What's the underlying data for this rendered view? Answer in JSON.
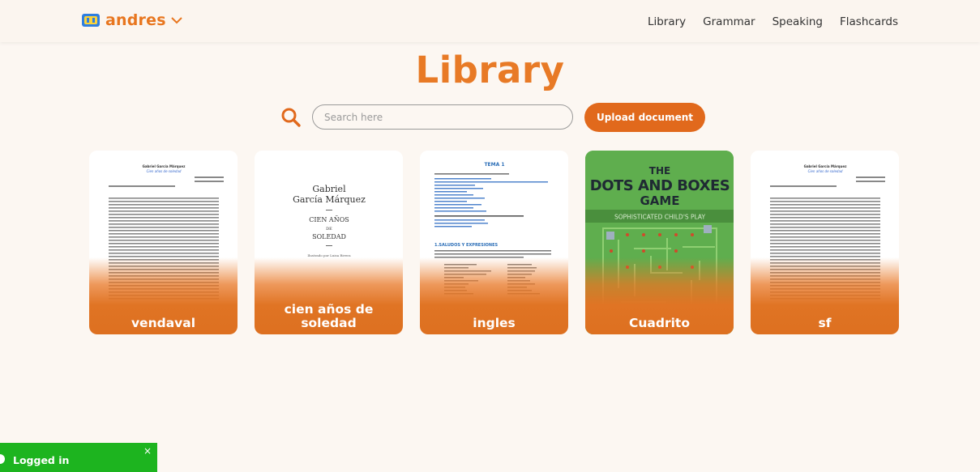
{
  "header": {
    "brand_name": "andres",
    "nav": [
      "Library",
      "Grammar",
      "Speaking",
      "Flashcards"
    ]
  },
  "main": {
    "title": "Library",
    "search": {
      "placeholder": "Search here",
      "value": ""
    },
    "upload_label": "Upload document",
    "documents": [
      {
        "name": "vendaval"
      },
      {
        "name": "cien años de soledad"
      },
      {
        "name": "ingles"
      },
      {
        "name": "Cuadrito"
      },
      {
        "name": "sf"
      }
    ],
    "thumbs": {
      "novel_author": "Gabriel García Márquez",
      "novel_title_small": "Cien años de soledad",
      "book_author_1": "Gabriel",
      "book_author_2": "García Márquez",
      "book_title_1": "CIEN AÑOS",
      "book_title_2": "DE",
      "book_title_3": "SOLEDAD",
      "book_illustrated": "Ilustrado por Luisa Rivera",
      "tema_title": "TEMA 1",
      "tema_section": "1.SALUDOS Y EXPRESIONES",
      "game_title_1": "THE",
      "game_title_2": "DOTS AND BOXES",
      "game_title_3": "GAME",
      "game_subtitle": "SOPHISTICATED CHILD'S PLAY"
    }
  },
  "toast": {
    "message": "Logged in",
    "close": "×"
  },
  "colors": {
    "accent": "#e1691c",
    "title": "#e87a26",
    "background": "#fcf7f2",
    "toast": "#1db41f"
  }
}
